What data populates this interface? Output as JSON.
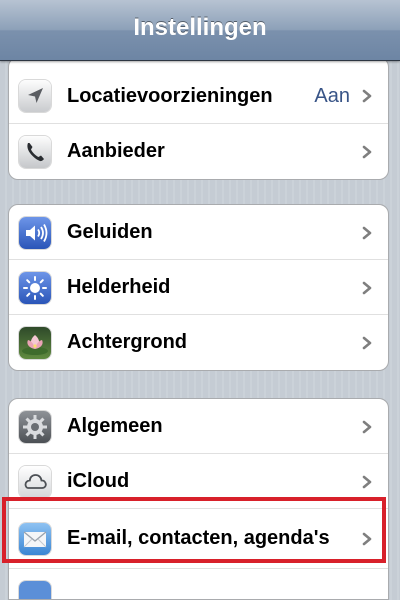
{
  "header": {
    "title": "Instellingen"
  },
  "groups": [
    {
      "rows": [
        {
          "label": "Locatievoorzieningen",
          "value": "Aan",
          "icon": "location-arrow-icon"
        },
        {
          "label": "Aanbieder",
          "icon": "phone-icon"
        }
      ]
    },
    {
      "rows": [
        {
          "label": "Geluiden",
          "icon": "speaker-icon"
        },
        {
          "label": "Helderheid",
          "icon": "brightness-icon"
        },
        {
          "label": "Achtergrond",
          "icon": "wallpaper-flower-icon"
        }
      ]
    },
    {
      "rows": [
        {
          "label": "Algemeen",
          "icon": "gear-icon"
        },
        {
          "label": "iCloud",
          "icon": "cloud-icon"
        },
        {
          "label": "E-mail, contacten, agenda's",
          "icon": "mail-envelope-icon"
        }
      ]
    }
  ],
  "highlight_color": "#d8202a"
}
